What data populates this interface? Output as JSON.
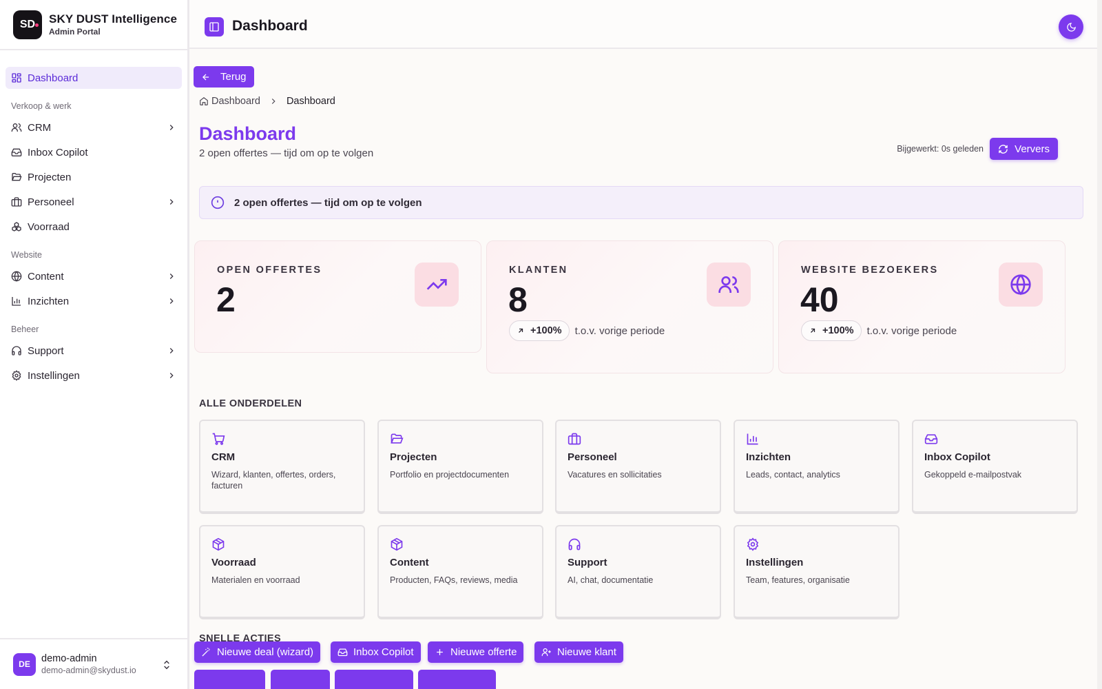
{
  "brand": {
    "logo_text": "SD",
    "title": "SKY DUST Intelligence",
    "subtitle": "Admin Portal"
  },
  "sidebar": {
    "items": [
      {
        "label": "Dashboard",
        "icon": "dashboard-icon",
        "active": true
      },
      {
        "section": "Verkoop & werk"
      },
      {
        "label": "CRM",
        "icon": "users-icon",
        "expandable": true
      },
      {
        "label": "Inbox Copilot",
        "icon": "inbox-icon"
      },
      {
        "label": "Projecten",
        "icon": "folder-icon"
      },
      {
        "label": "Personeel",
        "icon": "briefcase-icon",
        "expandable": true
      },
      {
        "label": "Voorraad",
        "icon": "boxes-icon"
      },
      {
        "section": "Website"
      },
      {
        "label": "Content",
        "icon": "globe-icon",
        "expandable": true
      },
      {
        "label": "Inzichten",
        "icon": "bar-chart-icon",
        "expandable": true
      },
      {
        "section": "Beheer"
      },
      {
        "label": "Support",
        "icon": "headphones-icon",
        "expandable": true
      },
      {
        "label": "Instellingen",
        "icon": "gear-icon",
        "expandable": true
      }
    ],
    "sections": {
      "sales": "Verkoop & werk",
      "website": "Website",
      "admin": "Beheer"
    },
    "labels": {
      "dashboard": "Dashboard",
      "crm": "CRM",
      "inbox": "Inbox Copilot",
      "projects": "Projecten",
      "staff": "Personeel",
      "stock": "Voorraad",
      "content": "Content",
      "insights": "Inzichten",
      "support": "Support",
      "settings": "Instellingen"
    }
  },
  "user": {
    "initials": "DE",
    "name": "demo-admin",
    "email": "demo-admin@skydust.io"
  },
  "header": {
    "title": "Dashboard"
  },
  "main": {
    "back_label": "Terug",
    "breadcrumb": [
      "Dashboard",
      "Dashboard"
    ],
    "title": "Dashboard",
    "subtitle": "2 open offertes — tijd om op te volgen",
    "updated": "Bijgewerkt: 0s geleden",
    "refresh_label": "Ververs",
    "alert": "2 open offertes — tijd om op te volgen"
  },
  "stats": [
    {
      "label": "OPEN OFFERTES",
      "value": "2",
      "icon": "trending-up-icon"
    },
    {
      "label": "KLANTEN",
      "value": "8",
      "icon": "users-icon",
      "trend": "+100%",
      "trend_text": "t.o.v. vorige periode"
    },
    {
      "label": "WEBSITE BEZOEKERS",
      "value": "40",
      "icon": "globe-icon",
      "trend": "+100%",
      "trend_text": "t.o.v. vorige periode"
    }
  ],
  "sections": {
    "all": "ALLE ONDERDELEN",
    "quick": "SNELLE ACTIES"
  },
  "tiles": [
    {
      "title": "CRM",
      "desc": "Wizard, klanten, offertes, orders, facturen",
      "icon": "cart-icon"
    },
    {
      "title": "Projecten",
      "desc": "Portfolio en projectdocumenten",
      "icon": "folder-icon"
    },
    {
      "title": "Personeel",
      "desc": "Vacatures en sollicitaties",
      "icon": "briefcase-icon"
    },
    {
      "title": "Inzichten",
      "desc": "Leads, contact, analytics",
      "icon": "bar-chart-icon"
    },
    {
      "title": "Inbox Copilot",
      "desc": "Gekoppeld e-mailpostvak",
      "icon": "inbox-icon"
    },
    {
      "title": "Voorraad",
      "desc": "Materialen en voorraad",
      "icon": "package-icon"
    },
    {
      "title": "Content",
      "desc": "Producten, FAQs, reviews, media",
      "icon": "package-icon"
    },
    {
      "title": "Support",
      "desc": "AI, chat, documentatie",
      "icon": "headphones-icon"
    },
    {
      "title": "Instellingen",
      "desc": "Team, features, organisatie",
      "icon": "gear-icon"
    }
  ],
  "quick_actions": [
    {
      "label": "Nieuwe deal (wizard)",
      "icon": "magic-wand-icon"
    },
    {
      "label": "Inbox Copilot",
      "icon": "inbox-icon"
    },
    {
      "label": "Nieuwe offerte",
      "icon": "plus-icon"
    },
    {
      "label": "Nieuwe klant",
      "icon": "user-plus-icon"
    }
  ],
  "colors": {
    "accent": "#7c3aed",
    "accent_soft": "#f0ebfb",
    "stat_icon_bg": "#fbdde3"
  }
}
